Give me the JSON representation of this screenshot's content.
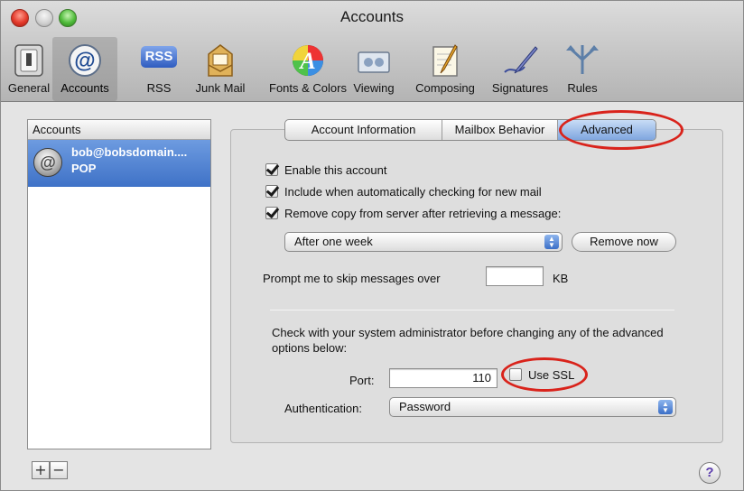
{
  "window": {
    "title": "Accounts"
  },
  "toolbar": {
    "items": [
      {
        "label": "General",
        "icon": "general-switch-icon"
      },
      {
        "label": "Accounts",
        "icon": "at-sign-icon",
        "selected": true
      },
      {
        "label": "RSS",
        "icon": "rss-icon"
      },
      {
        "label": "Junk Mail",
        "icon": "junk-mail-icon"
      },
      {
        "label": "Fonts & Colors",
        "icon": "font-icon"
      },
      {
        "label": "Viewing",
        "icon": "viewing-icon"
      },
      {
        "label": "Composing",
        "icon": "composing-icon"
      },
      {
        "label": "Signatures",
        "icon": "signature-pen-icon"
      },
      {
        "label": "Rules",
        "icon": "rules-icon"
      }
    ],
    "rss_badge": "RSS"
  },
  "sidebar": {
    "header": "Accounts",
    "accounts": [
      {
        "name": "bob@bobsdomain....",
        "type": "POP",
        "avatar_glyph": "@"
      }
    ],
    "add_label": "+",
    "remove_label": "−"
  },
  "tabs": {
    "items": [
      "Account Information",
      "Mailbox Behavior",
      "Advanced"
    ],
    "active": "Advanced"
  },
  "advanced": {
    "enable_account": {
      "label": "Enable this account",
      "checked": true
    },
    "include_check": {
      "label": "Include when automatically checking for new mail",
      "checked": true
    },
    "remove_copy": {
      "label": "Remove copy from server after retrieving a message:",
      "checked": true
    },
    "remove_after": {
      "selected": "After one week"
    },
    "remove_now_label": "Remove now",
    "prompt_label": "Prompt me to skip messages over",
    "prompt_value": "",
    "prompt_unit": "KB",
    "notice": "Check with your system administrator before changing any of the advanced options below:",
    "port_label": "Port:",
    "port_value": "110",
    "ssl": {
      "label": "Use SSL",
      "checked": false
    },
    "auth_label": "Authentication:",
    "auth_value": "Password"
  },
  "help_label": "?",
  "colors": {
    "highlight_circle": "#d9231b",
    "selection": "#3f72c7"
  }
}
